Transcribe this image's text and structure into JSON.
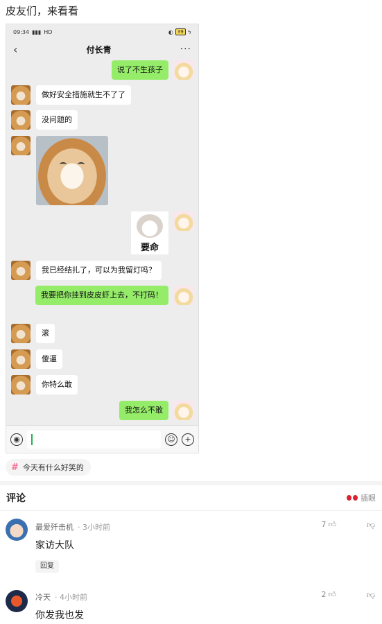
{
  "post": {
    "title": "皮友们，来看看"
  },
  "phone": {
    "status": {
      "time": "09:34",
      "network": "HD",
      "battery": "39"
    },
    "chat_title": "付长青",
    "messages": [
      {
        "side": "right",
        "type": "text",
        "text": "说了不生孩子"
      },
      {
        "side": "left",
        "type": "text",
        "text": "做好安全措施就生不了了"
      },
      {
        "side": "left",
        "type": "text",
        "text": "没问题的"
      },
      {
        "side": "left",
        "type": "sticker",
        "sticker": "smiling-shiba-dog"
      },
      {
        "side": "right",
        "type": "sticker",
        "sticker": "cat",
        "text": "要命"
      },
      {
        "side": "left",
        "type": "text",
        "text": "我已经结扎了，可以为我留灯吗？"
      },
      {
        "side": "right",
        "type": "text",
        "text": "我要把你挂到皮皮虾上去，不打码！"
      },
      {
        "side": "left",
        "type": "text",
        "text": "滚"
      },
      {
        "side": "left",
        "type": "text",
        "text": "傻逼"
      },
      {
        "side": "left",
        "type": "text",
        "text": "你特么敢"
      },
      {
        "side": "right",
        "type": "text",
        "text": "我怎么不敢"
      }
    ]
  },
  "topic": {
    "label": "今天有什么好笑的"
  },
  "comments_header": {
    "title": "评论",
    "action": "插眼"
  },
  "comments": [
    {
      "user": "最爱歼击机",
      "time": "· 3小时前",
      "text": "家访大队",
      "likes": "7",
      "reply_label": "回复"
    },
    {
      "user": "冷天",
      "time": "· 4小时前",
      "text": "你发我也发",
      "likes": "2"
    }
  ],
  "colors": {
    "wechat_green": "#95ec69",
    "chat_bg": "#ededed",
    "topic_hash": "#fb7299"
  }
}
